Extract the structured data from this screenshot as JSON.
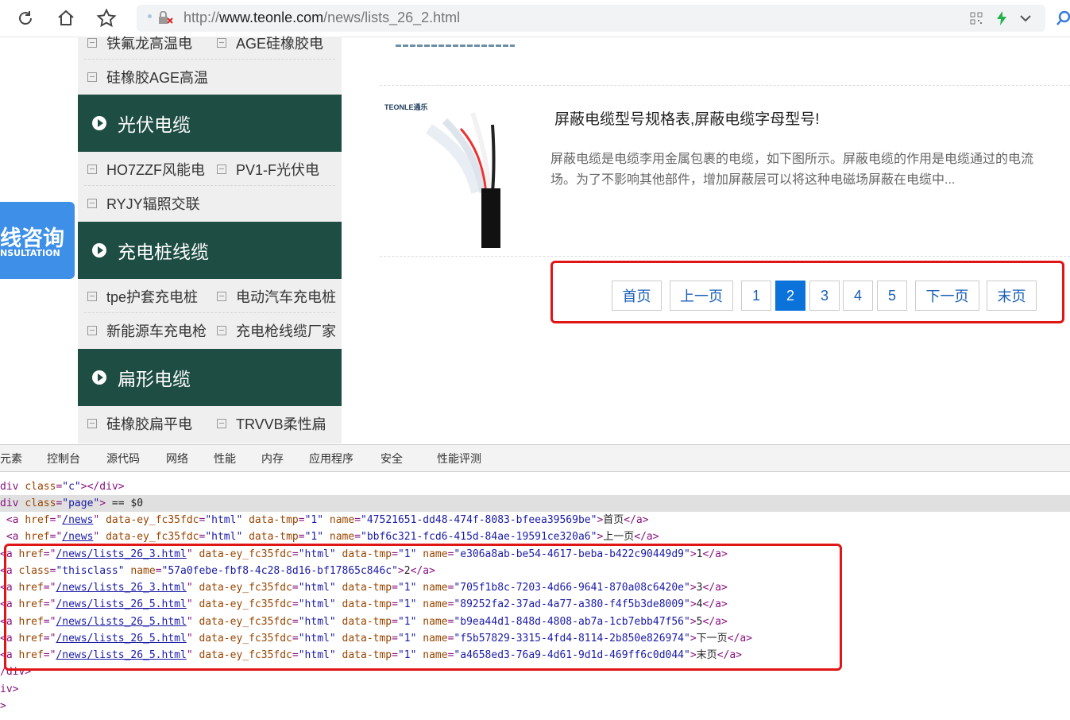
{
  "browser": {
    "url_prefix": "http://",
    "url_domain": "www.teonle.com",
    "url_path": "/news/lists_26_2.html"
  },
  "sidebar": {
    "partial_row": [
      "铁氟龙高温电",
      "AGE硅橡胶电"
    ],
    "row2": [
      "硅橡胶AGE高温"
    ],
    "categories": [
      {
        "title": "光伏电缆",
        "rows": [
          [
            "HO7ZZF风能电",
            "PV1-F光伏电"
          ],
          [
            "RYJY辐照交联"
          ]
        ]
      },
      {
        "title": "充电桩线缆",
        "rows": [
          [
            "tpe护套充电桩",
            "电动汽车充电桩"
          ],
          [
            "新能源车充电枪",
            "充电枪线缆厂家"
          ]
        ]
      },
      {
        "title": "扁形电缆",
        "rows": [
          [
            "硅橡胶扁平电",
            "TRVVB柔性扁"
          ]
        ]
      }
    ]
  },
  "consult": {
    "title": "线咨询",
    "subtitle": "NSULTATION"
  },
  "article": {
    "title": "屏蔽电缆型号规格表,屏蔽电缆字母型号!",
    "excerpt_line1": "屏蔽电缆是电缆李用金属包裹的电缆，如下图所示。屏蔽电缆的作用是电缆通过的电流",
    "excerpt_line2": "场。为了不影响其他部件，增加屏蔽层可以将这种电磁场屏蔽在电缆中...",
    "thumb_logo": "TEONLE通乐"
  },
  "pagination": {
    "first": "首页",
    "prev": "上一页",
    "pages": [
      "1",
      "2",
      "3",
      "4",
      "5"
    ],
    "current": "2",
    "next": "下一页",
    "last": "末页"
  },
  "devtools": {
    "tabs": [
      "元素",
      "控制台",
      "源代码",
      "网络",
      "性能",
      "内存",
      "应用程序",
      "安全",
      "性能评测"
    ],
    "lines": [
      {
        "indent": "",
        "parts": [
          [
            "tg",
            "div "
          ],
          [
            "an",
            "class"
          ],
          [
            "tg",
            "="
          ],
          [
            "av",
            "\"c\""
          ],
          [
            "tg",
            "></div>"
          ]
        ]
      },
      {
        "indent": "",
        "sel": true,
        "parts": [
          [
            "tg",
            "div "
          ],
          [
            "an",
            "class"
          ],
          [
            "tg",
            "="
          ],
          [
            "av",
            "\"page\""
          ],
          [
            "tg",
            ">"
          ],
          [
            "tx",
            " == $0"
          ]
        ]
      },
      {
        "indent": " ",
        "parts": [
          [
            "tg",
            "<a "
          ],
          [
            "an",
            "href"
          ],
          [
            "tg",
            "=\""
          ],
          [
            "lk",
            "/news"
          ],
          [
            "tg",
            "\" "
          ],
          [
            "an",
            "data-ey_fc35fdc"
          ],
          [
            "tg",
            "="
          ],
          [
            "av",
            "\"html\""
          ],
          [
            "tg",
            " "
          ],
          [
            "an",
            "data-tmp"
          ],
          [
            "tg",
            "="
          ],
          [
            "av",
            "\"1\""
          ],
          [
            "tg",
            " "
          ],
          [
            "an",
            "name"
          ],
          [
            "tg",
            "="
          ],
          [
            "av",
            "\"47521651-dd48-474f-8083-bfeea39569be\""
          ],
          [
            "tg",
            ">"
          ],
          [
            "tx",
            "首页"
          ],
          [
            "tg",
            "</a>"
          ]
        ]
      },
      {
        "indent": " ",
        "parts": [
          [
            "tg",
            "<a "
          ],
          [
            "an",
            "href"
          ],
          [
            "tg",
            "=\""
          ],
          [
            "lk",
            "/news"
          ],
          [
            "tg",
            "\" "
          ],
          [
            "an",
            "data-ey_fc35fdc"
          ],
          [
            "tg",
            "="
          ],
          [
            "av",
            "\"html\""
          ],
          [
            "tg",
            " "
          ],
          [
            "an",
            "data-tmp"
          ],
          [
            "tg",
            "="
          ],
          [
            "av",
            "\"1\""
          ],
          [
            "tg",
            " "
          ],
          [
            "an",
            "name"
          ],
          [
            "tg",
            "="
          ],
          [
            "av",
            "\"bbf6c321-fcd6-415d-84ae-19591ce320a6\""
          ],
          [
            "tg",
            ">"
          ],
          [
            "tx",
            "上一页"
          ],
          [
            "tg",
            "</a>"
          ]
        ]
      },
      {
        "indent": "",
        "parts": [
          [
            "tg",
            "<a "
          ],
          [
            "an",
            "href"
          ],
          [
            "tg",
            "=\""
          ],
          [
            "lk",
            "/news/lists_26_3.html"
          ],
          [
            "tg",
            "\" "
          ],
          [
            "an",
            "data-ey_fc35fdc"
          ],
          [
            "tg",
            "="
          ],
          [
            "av",
            "\"html\""
          ],
          [
            "tg",
            " "
          ],
          [
            "an",
            "data-tmp"
          ],
          [
            "tg",
            "="
          ],
          [
            "av",
            "\"1\""
          ],
          [
            "tg",
            " "
          ],
          [
            "an",
            "name"
          ],
          [
            "tg",
            "="
          ],
          [
            "av",
            "\"e306a8ab-be54-4617-beba-b422c90449d9\""
          ],
          [
            "tg",
            ">"
          ],
          [
            "tx",
            "1"
          ],
          [
            "tg",
            "</a>"
          ]
        ]
      },
      {
        "indent": "",
        "parts": [
          [
            "tg",
            "<a "
          ],
          [
            "an",
            "class"
          ],
          [
            "tg",
            "="
          ],
          [
            "av",
            "\"thisclass\""
          ],
          [
            "tg",
            " "
          ],
          [
            "an",
            "name"
          ],
          [
            "tg",
            "="
          ],
          [
            "av",
            "\"57a0febe-fbf8-4c28-8d16-bf17865c846c\""
          ],
          [
            "tg",
            ">"
          ],
          [
            "tx",
            "2"
          ],
          [
            "tg",
            "</a>"
          ]
        ]
      },
      {
        "indent": "",
        "parts": [
          [
            "tg",
            "<a "
          ],
          [
            "an",
            "href"
          ],
          [
            "tg",
            "=\""
          ],
          [
            "lk",
            "/news/lists_26_3.html"
          ],
          [
            "tg",
            "\" "
          ],
          [
            "an",
            "data-ey_fc35fdc"
          ],
          [
            "tg",
            "="
          ],
          [
            "av",
            "\"html\""
          ],
          [
            "tg",
            " "
          ],
          [
            "an",
            "data-tmp"
          ],
          [
            "tg",
            "="
          ],
          [
            "av",
            "\"1\""
          ],
          [
            "tg",
            " "
          ],
          [
            "an",
            "name"
          ],
          [
            "tg",
            "="
          ],
          [
            "av",
            "\"705f1b8c-7203-4d66-9641-870a08c6420e\""
          ],
          [
            "tg",
            ">"
          ],
          [
            "tx",
            "3"
          ],
          [
            "tg",
            "</a>"
          ]
        ]
      },
      {
        "indent": "",
        "parts": [
          [
            "tg",
            "<a "
          ],
          [
            "an",
            "href"
          ],
          [
            "tg",
            "=\""
          ],
          [
            "lk",
            "/news/lists_26_5.html"
          ],
          [
            "tg",
            "\" "
          ],
          [
            "an",
            "data-ey_fc35fdc"
          ],
          [
            "tg",
            "="
          ],
          [
            "av",
            "\"html\""
          ],
          [
            "tg",
            " "
          ],
          [
            "an",
            "data-tmp"
          ],
          [
            "tg",
            "="
          ],
          [
            "av",
            "\"1\""
          ],
          [
            "tg",
            " "
          ],
          [
            "an",
            "name"
          ],
          [
            "tg",
            "="
          ],
          [
            "av",
            "\"89252fa2-37ad-4a77-a380-f4f5b3de8009\""
          ],
          [
            "tg",
            ">"
          ],
          [
            "tx",
            "4"
          ],
          [
            "tg",
            "</a>"
          ]
        ]
      },
      {
        "indent": "",
        "parts": [
          [
            "tg",
            "<a "
          ],
          [
            "an",
            "href"
          ],
          [
            "tg",
            "=\""
          ],
          [
            "lk",
            "/news/lists_26_5.html"
          ],
          [
            "tg",
            "\" "
          ],
          [
            "an",
            "data-ey_fc35fdc"
          ],
          [
            "tg",
            "="
          ],
          [
            "av",
            "\"html\""
          ],
          [
            "tg",
            " "
          ],
          [
            "an",
            "data-tmp"
          ],
          [
            "tg",
            "="
          ],
          [
            "av",
            "\"1\""
          ],
          [
            "tg",
            " "
          ],
          [
            "an",
            "name"
          ],
          [
            "tg",
            "="
          ],
          [
            "av",
            "\"b9ea44d1-848d-4808-ab7a-1cb7ebb47f56\""
          ],
          [
            "tg",
            ">"
          ],
          [
            "tx",
            "5"
          ],
          [
            "tg",
            "</a>"
          ]
        ]
      },
      {
        "indent": "",
        "parts": [
          [
            "tg",
            "<a "
          ],
          [
            "an",
            "href"
          ],
          [
            "tg",
            "=\""
          ],
          [
            "lk",
            "/news/lists_26_5.html"
          ],
          [
            "tg",
            "\" "
          ],
          [
            "an",
            "data-ey_fc35fdc"
          ],
          [
            "tg",
            "="
          ],
          [
            "av",
            "\"html\""
          ],
          [
            "tg",
            " "
          ],
          [
            "an",
            "data-tmp"
          ],
          [
            "tg",
            "="
          ],
          [
            "av",
            "\"1\""
          ],
          [
            "tg",
            " "
          ],
          [
            "an",
            "name"
          ],
          [
            "tg",
            "="
          ],
          [
            "av",
            "\"f5b57829-3315-4fd4-8114-2b850e826974\""
          ],
          [
            "tg",
            ">"
          ],
          [
            "tx",
            "下一页"
          ],
          [
            "tg",
            "</a>"
          ]
        ]
      },
      {
        "indent": "",
        "parts": [
          [
            "tg",
            "<a "
          ],
          [
            "an",
            "href"
          ],
          [
            "tg",
            "=\""
          ],
          [
            "lk",
            "/news/lists_26_5.html"
          ],
          [
            "tg",
            "\" "
          ],
          [
            "an",
            "data-ey_fc35fdc"
          ],
          [
            "tg",
            "="
          ],
          [
            "av",
            "\"html\""
          ],
          [
            "tg",
            " "
          ],
          [
            "an",
            "data-tmp"
          ],
          [
            "tg",
            "="
          ],
          [
            "av",
            "\"1\""
          ],
          [
            "tg",
            " "
          ],
          [
            "an",
            "name"
          ],
          [
            "tg",
            "="
          ],
          [
            "av",
            "\"a4658ed3-76a9-4d61-9d1d-469ff6c0d044\""
          ],
          [
            "tg",
            ">"
          ],
          [
            "tx",
            "末页"
          ],
          [
            "tg",
            "</a>"
          ]
        ]
      },
      {
        "indent": "",
        "parts": [
          [
            "tg",
            "/div>"
          ]
        ]
      },
      {
        "indent": "",
        "parts": [
          [
            "tg",
            "iv>"
          ]
        ]
      },
      {
        "indent": "",
        "parts": [
          [
            "tg",
            ">"
          ]
        ]
      }
    ]
  }
}
